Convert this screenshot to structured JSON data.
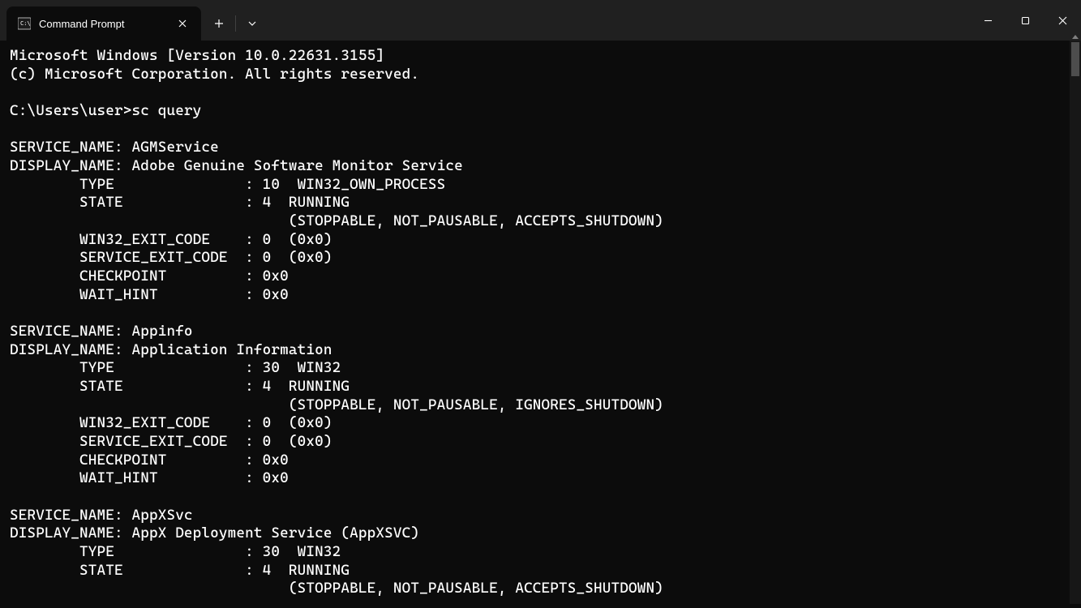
{
  "tab": {
    "title": "Command Prompt"
  },
  "terminal": {
    "header_line1": "Microsoft Windows [Version 10.0.22631.3155]",
    "header_line2": "(c) Microsoft Corporation. All rights reserved.",
    "prompt": "C:\\Users\\user>",
    "command": "sc query",
    "services": [
      {
        "service_name": "AGMService",
        "display_name": "Adobe Genuine Software Monitor Service",
        "type_code": "10",
        "type_label": "WIN32_OWN_PROCESS",
        "state_code": "4",
        "state_label": "RUNNING",
        "state_flags": "(STOPPABLE, NOT_PAUSABLE, ACCEPTS_SHUTDOWN)",
        "win32_exit_code": "0  (0x0)",
        "service_exit_code": "0  (0x0)",
        "checkpoint": "0x0",
        "wait_hint": "0x0"
      },
      {
        "service_name": "Appinfo",
        "display_name": "Application Information",
        "type_code": "30",
        "type_label": "WIN32",
        "state_code": "4",
        "state_label": "RUNNING",
        "state_flags": "(STOPPABLE, NOT_PAUSABLE, IGNORES_SHUTDOWN)",
        "win32_exit_code": "0  (0x0)",
        "service_exit_code": "0  (0x0)",
        "checkpoint": "0x0",
        "wait_hint": "0x0"
      },
      {
        "service_name": "AppXSvc",
        "display_name": "AppX Deployment Service (AppXSVC)",
        "type_code": "30",
        "type_label": "WIN32",
        "state_code": "4",
        "state_label": "RUNNING",
        "state_flags": "(STOPPABLE, NOT_PAUSABLE, ACCEPTS_SHUTDOWN)"
      }
    ]
  },
  "labels": {
    "service_name": "SERVICE_NAME:",
    "display_name": "DISPLAY_NAME:",
    "type": "TYPE",
    "state": "STATE",
    "win32_exit": "WIN32_EXIT_CODE",
    "svc_exit": "SERVICE_EXIT_CODE",
    "checkpoint": "CHECKPOINT",
    "wait_hint": "WAIT_HINT"
  }
}
